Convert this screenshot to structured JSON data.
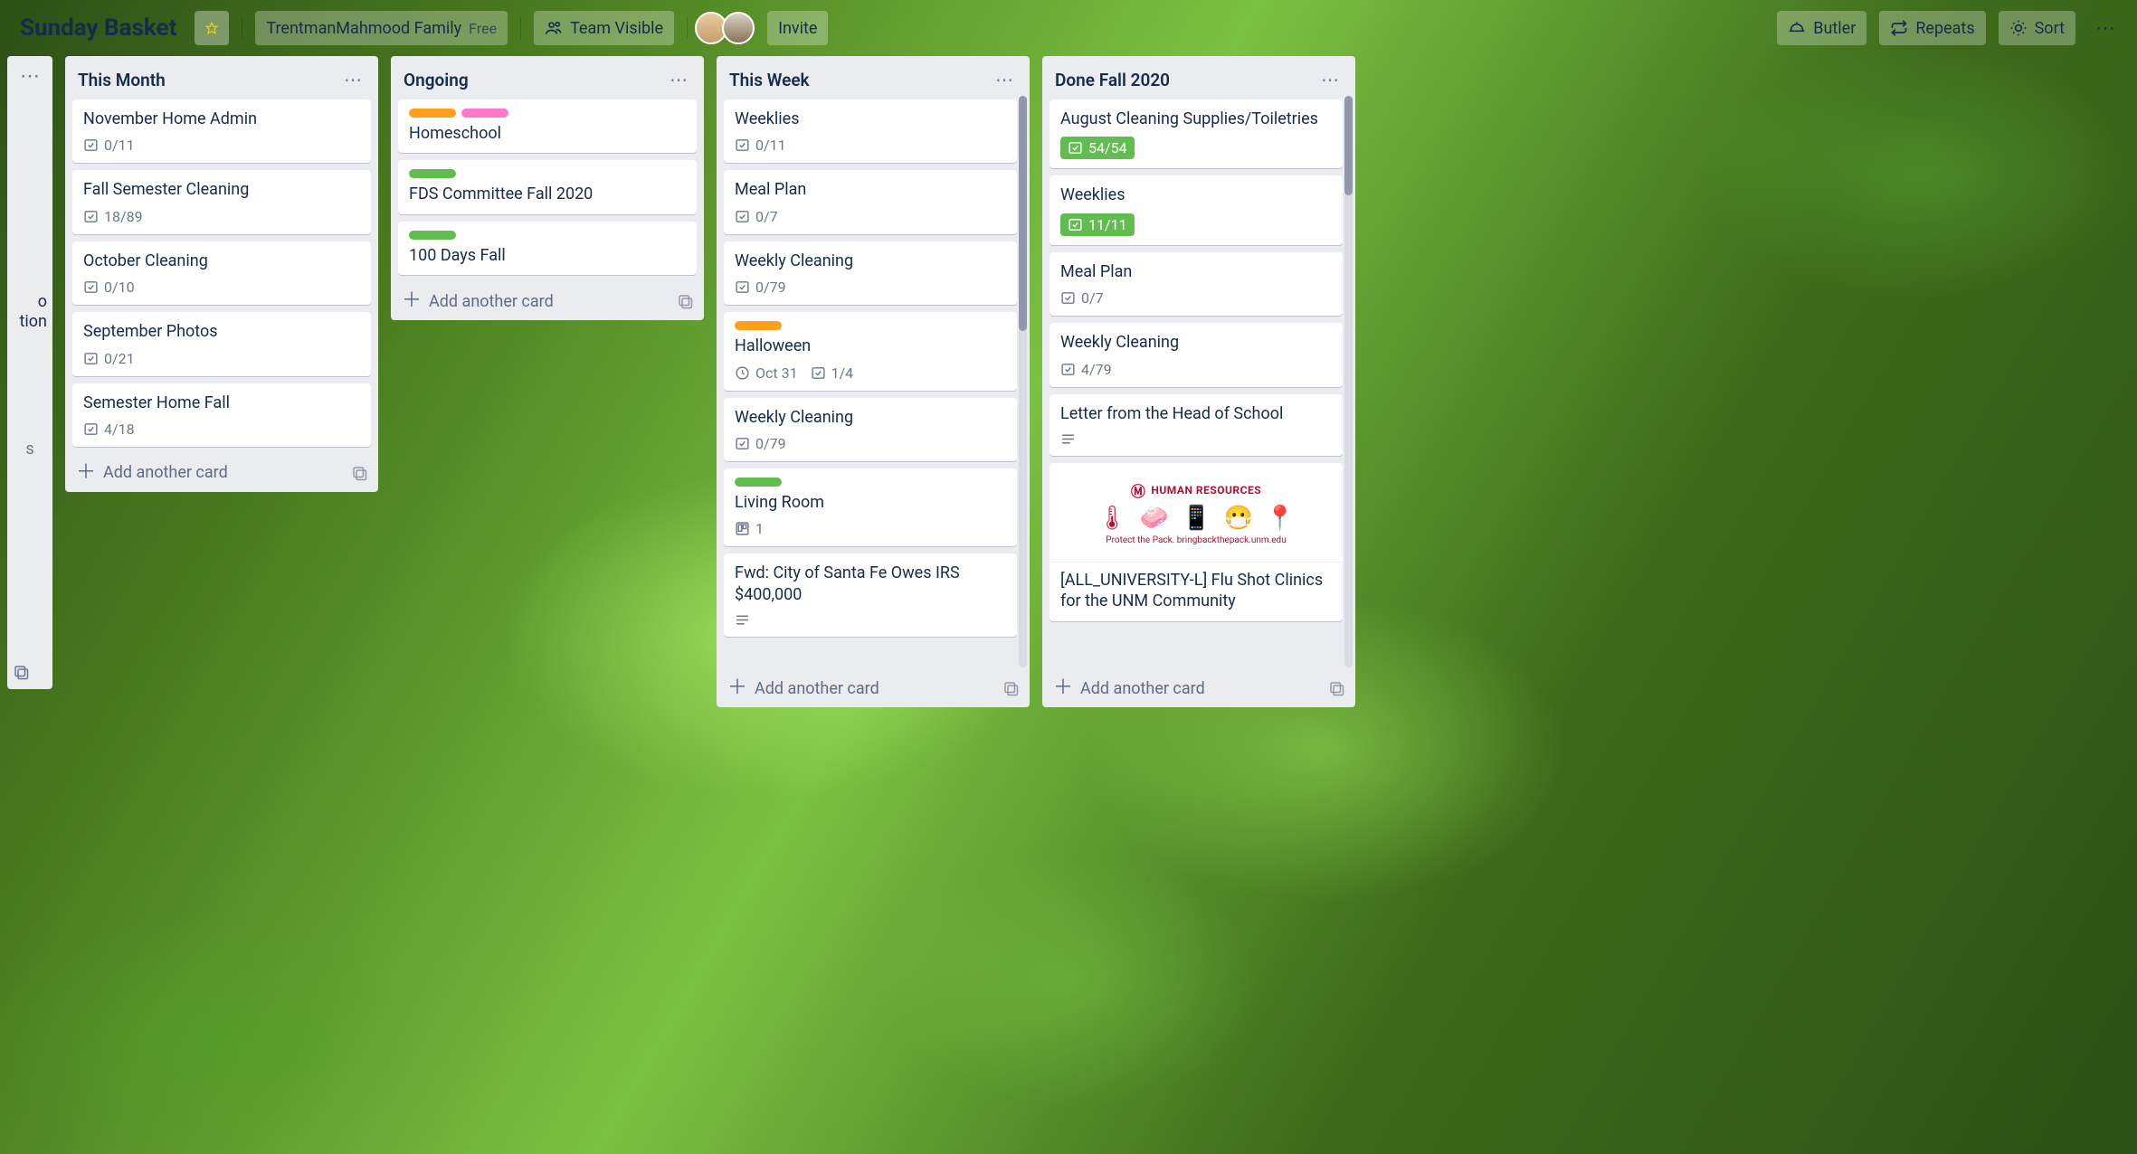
{
  "header": {
    "board_title": "Sunday Basket",
    "workspace": "TrentmanMahmood Family",
    "plan": "Free",
    "visibility": "Team Visible",
    "invite": "Invite",
    "butler": "Butler",
    "repeats": "Repeats",
    "sort": "Sort"
  },
  "stub_left": {
    "line1": "o",
    "line2": "tion"
  },
  "lists": [
    {
      "title": "This Month",
      "add": "Add another card",
      "cards": [
        {
          "title": "November Home Admin",
          "check": "0/11"
        },
        {
          "title": "Fall Semester Cleaning",
          "check": "18/89"
        },
        {
          "title": "October Cleaning",
          "check": "0/10"
        },
        {
          "title": "September Photos",
          "check": "0/21"
        },
        {
          "title": "Semester Home Fall",
          "check": "4/18"
        }
      ]
    },
    {
      "title": "Ongoing",
      "add": "Add another card",
      "cards": [
        {
          "title": "Homeschool",
          "labels": [
            "orange",
            "pink"
          ]
        },
        {
          "title": "FDS Committee Fall 2020",
          "labels": [
            "green"
          ]
        },
        {
          "title": "100 Days Fall",
          "labels": [
            "green"
          ]
        }
      ]
    },
    {
      "title": "This Week",
      "add": "Add another card",
      "cards": [
        {
          "title": "Weeklies",
          "check": "0/11"
        },
        {
          "title": "Meal Plan",
          "check": "0/7"
        },
        {
          "title": "Weekly Cleaning",
          "check": "0/79"
        },
        {
          "title": "Halloween",
          "labels": [
            "orange"
          ],
          "due": "Oct 31",
          "check": "1/4"
        },
        {
          "title": "Weekly Cleaning",
          "check": "0/79"
        },
        {
          "title": "Living Room",
          "labels": [
            "green"
          ],
          "trello": "1"
        },
        {
          "title": "Fwd: City of Santa Fe Owes IRS $400,000",
          "desc": true
        }
      ]
    },
    {
      "title": "Done Fall 2020",
      "add": "Add another card",
      "cards": [
        {
          "title": "August Cleaning Supplies/Toiletries",
          "check": "54/54",
          "done": true
        },
        {
          "title": "Weeklies",
          "check": "11/11",
          "done": true
        },
        {
          "title": "Meal Plan",
          "check": "0/7"
        },
        {
          "title": "Weekly Cleaning",
          "check": "4/79"
        },
        {
          "title": "Letter from the Head of School",
          "desc": true
        },
        {
          "title": "[ALL_UNIVERSITY-L] Flu Shot Clinics for the UNM Community",
          "cover": true,
          "cover_top": "HUMAN RESOURCES",
          "cover_bot": "Protect the Pack. bringbackthepack.unm.edu"
        }
      ]
    }
  ]
}
